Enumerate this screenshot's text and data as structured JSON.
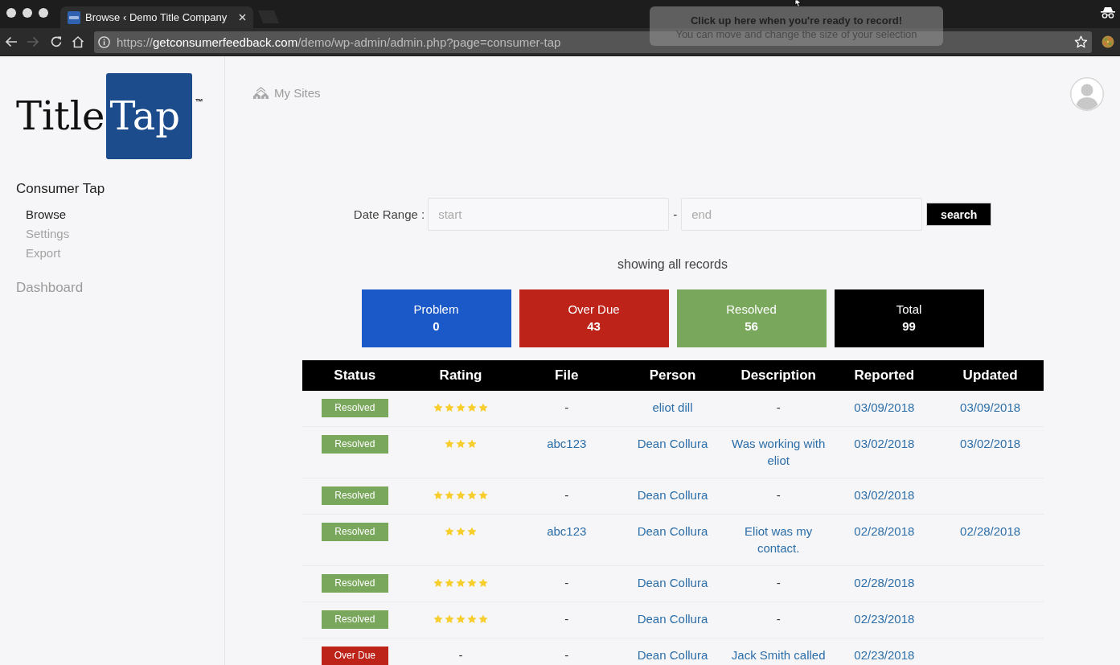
{
  "browser": {
    "tab": {
      "title": "Browse ‹ Demo Title Company"
    },
    "back": {
      "disabled": false
    },
    "forward": {
      "disabled": true
    },
    "url": {
      "scheme": "https://",
      "host": "getconsumerfeedback.com",
      "path": "/demo/wp-admin/admin.php?page=consumer-tap"
    }
  },
  "recorder_prompt": {
    "title": "Click up here when you're ready to record!",
    "subtitle": "You can move and change the size of your selection"
  },
  "logo": {
    "word": "Title",
    "tile": "Tap",
    "mark": "™"
  },
  "sidebar": {
    "sections": [
      {
        "label": "Consumer Tap",
        "selected": true,
        "items": [
          {
            "label": "Browse",
            "selected": true
          },
          {
            "label": "Settings",
            "selected": false
          },
          {
            "label": "Export",
            "selected": false
          }
        ]
      },
      {
        "label": "Dashboard",
        "selected": false
      }
    ]
  },
  "top_bar": {
    "link": "My Sites"
  },
  "filter": {
    "label": "Date Range :",
    "start": {
      "placeholder": "start"
    },
    "separator": "-",
    "end": {
      "placeholder": "end"
    },
    "button": "search"
  },
  "summary": "showing all records",
  "stats": [
    {
      "label": "Problem",
      "value": "0",
      "color": "#1b58c8"
    },
    {
      "label": "Over Due",
      "value": "43",
      "color": "#bd2319"
    },
    {
      "label": "Resolved",
      "value": "56",
      "color": "#79a75b"
    },
    {
      "label": "Total",
      "value": "99",
      "color": "#000000"
    }
  ],
  "table": {
    "columns": [
      "Status",
      "Rating",
      "File",
      "Person",
      "Description",
      "Reported",
      "Updated"
    ],
    "rows": [
      {
        "status": {
          "label": "Resolved",
          "color": "#79a75b"
        },
        "stars": 5,
        "file": {
          "text": "-",
          "link": false
        },
        "person": "eliot dill",
        "description": {
          "text": "-",
          "link": false
        },
        "reported": "03/09/2018",
        "updated": "03/09/2018"
      },
      {
        "status": {
          "label": "Resolved",
          "color": "#79a75b"
        },
        "stars": 3,
        "file": {
          "text": "abc123",
          "link": true
        },
        "person": "Dean Collura",
        "description": {
          "text": "Was working with eliot",
          "link": true
        },
        "reported": "03/02/2018",
        "updated": "03/02/2018"
      },
      {
        "status": {
          "label": "Resolved",
          "color": "#79a75b"
        },
        "stars": 5,
        "file": {
          "text": "-",
          "link": false
        },
        "person": "Dean Collura",
        "description": {
          "text": "-",
          "link": false
        },
        "reported": "03/02/2018"
      },
      {
        "status": {
          "label": "Resolved",
          "color": "#79a75b"
        },
        "stars": 3,
        "file": {
          "text": "abc123",
          "link": true
        },
        "person": "Dean Collura",
        "description": {
          "text": "Eliot was my contact.",
          "link": true
        },
        "reported": "02/28/2018",
        "updated": "02/28/2018"
      },
      {
        "status": {
          "label": "Resolved",
          "color": "#79a75b"
        },
        "stars": 5,
        "file": {
          "text": "-",
          "link": false
        },
        "person": "Dean Collura",
        "description": {
          "text": "-",
          "link": false
        },
        "reported": "02/28/2018"
      },
      {
        "status": {
          "label": "Resolved",
          "color": "#79a75b"
        },
        "stars": 5,
        "file": {
          "text": "-",
          "link": false
        },
        "person": "Dean Collura",
        "description": {
          "text": "-",
          "link": false
        },
        "reported": "02/23/2018"
      },
      {
        "status": {
          "label": "Over Due",
          "color": "#bd2319"
        },
        "rating": "-",
        "file": {
          "text": "-",
          "link": false
        },
        "person": "Dean Collura",
        "description": {
          "text": "Jack Smith called",
          "link": true
        },
        "reported": "02/23/2018"
      }
    ]
  }
}
